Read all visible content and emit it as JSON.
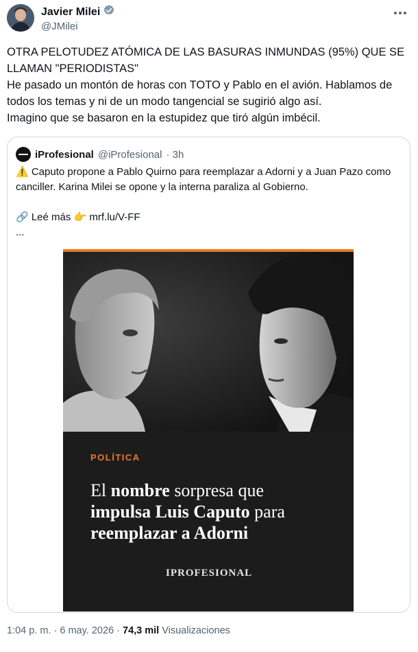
{
  "author": {
    "name": "Javier Milei",
    "handle": "@JMilei",
    "verified_color": "#829aab"
  },
  "tweet": {
    "text": "OTRA PELOTUDEZ ATÓMICA DE LAS BASURAS INMUNDAS (95%) QUE SE LLAMAN \"PERIODISTAS\"\nHe pasado un montón de horas con TOTO y Pablo en el avión. Hablamos de todos los temas y ni de un modo tangencial se sugirió algo así.\nImagino que se basaron en la estupidez que tiró algún imbécil."
  },
  "quote": {
    "name": "iProfesional",
    "handle": "@iProfesional",
    "time": "· 3h",
    "text": "⚠️ Caputo propone a Pablo Quirno para reemplazar a Adorni y a Juan Pazo como canciller. Karina Milei se opone y la interna paraliza al Gobierno.\n\n🔗 Leé más 👉 mrf.lu/V-FF\n...",
    "media": {
      "section": "POLÍTICA",
      "headline_1a": "El ",
      "headline_1b": "nombre",
      "headline_1c": " sorpresa que",
      "headline_2a": "impulsa Luis Caputo",
      "headline_2b": " para",
      "headline_3": "reemplazar a Adorni",
      "brand": "IPROFESIONAL",
      "accent_color": "#e8792b"
    }
  },
  "meta": {
    "time": "1:04 p. m.",
    "separator": " · ",
    "date": "6 may. 2026",
    "separator2": " · ",
    "views_count": "74,3 mil",
    "views_label": " Visualizaciones"
  },
  "colors": {
    "text": "#0f1419",
    "secondary": "#536471",
    "border": "#cfd9de"
  },
  "icons": [
    "verified-badge-icon",
    "more-options-icon",
    "warning-icon",
    "link-icon",
    "pointing-hand-icon"
  ]
}
